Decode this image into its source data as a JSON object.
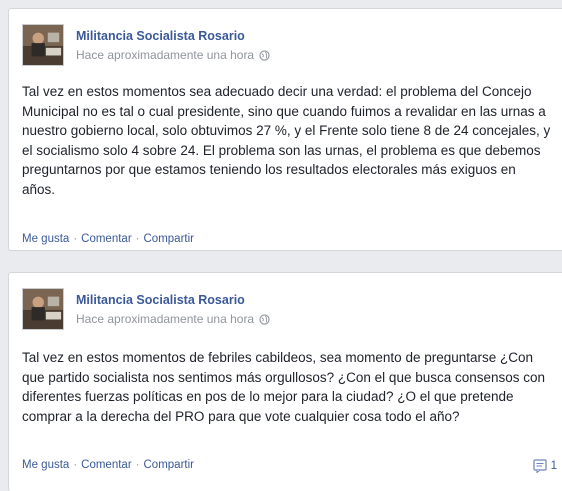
{
  "posts": [
    {
      "author": "Militancia Socialista Rosario",
      "timestamp": "Hace aproximadamente una hora",
      "text": "Tal vez en estos momentos sea adecuado decir una verdad: el problema del Concejo Municipal no es tal o cual presidente, sino que cuando fuimos a revalidar en las urnas a nuestro gobierno local, solo obtuvimos 27 %, y el Frente solo tiene 8 de 24 concejales, y el socialismo solo 4 sobre 24. El problema son las urnas, el problema es que debemos preguntarnos por que estamos teniendo los resultados electorales más exiguos en años.",
      "actions": {
        "like": "Me gusta",
        "comment": "Comentar",
        "share": "Compartir"
      }
    },
    {
      "author": "Militancia Socialista Rosario",
      "timestamp": "Hace aproximadamente una hora",
      "text": "Tal vez en estos momentos de febriles cabildeos, sea momento de preguntarse ¿Con que partido socialista nos sentimos más orgullosos? ¿Con el que busca consensos con diferentes fuerzas políticas en pos de lo mejor para la ciudad? ¿O el que pretende comprar a la derecha del PRO para que vote cualquier cosa todo el año?",
      "actions": {
        "like": "Me gusta",
        "comment": "Comentar",
        "share": "Compartir"
      },
      "comment_count": "1"
    }
  ],
  "icons": {
    "privacy": "globe-icon",
    "comments": "comment-icon"
  },
  "colors": {
    "link": "#3b5998",
    "meta": "#90949c",
    "text": "#1d2129"
  }
}
